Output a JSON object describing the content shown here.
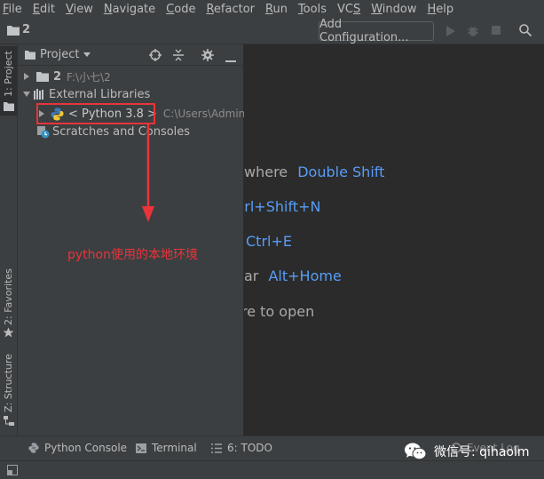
{
  "menubar": {
    "items": [
      {
        "label": "File",
        "mnemonic": "F",
        "rest": "ile"
      },
      {
        "label": "Edit",
        "mnemonic": "E",
        "rest": "dit"
      },
      {
        "label": "View",
        "mnemonic": "V",
        "rest": "iew"
      },
      {
        "label": "Navigate",
        "mnemonic": "N",
        "rest": "avigate"
      },
      {
        "label": "Code",
        "mnemonic": "C",
        "rest": "ode"
      },
      {
        "label": "Refactor",
        "mnemonic": "R",
        "rest": "efactor"
      },
      {
        "label": "Run",
        "mnemonic": "R",
        "rest": "un"
      },
      {
        "label": "Tools",
        "mnemonic": "T",
        "rest": "ools"
      },
      {
        "label": "VCS",
        "mnemonic": "S",
        "rest": "VC"
      },
      {
        "label": "Window",
        "mnemonic": "W",
        "rest": "indow"
      },
      {
        "label": "Help",
        "mnemonic": "H",
        "rest": "elp"
      }
    ]
  },
  "navbar": {
    "project_name": "2",
    "add_configuration": "Add Configuration..."
  },
  "left_stripe": {
    "project_tab": "1: Project",
    "favorites_tab": "2: Favorites",
    "structure_tab": "Z: Structure"
  },
  "project_panel": {
    "title": "Project",
    "tree": {
      "root_name": "2",
      "root_path": "F:\\小七\\2",
      "external_libraries": "External Libraries",
      "python_sdk": "< Python 3.8 >",
      "python_path": "C:\\Users\\Admin\\A",
      "scratches": "Scratches and Consoles"
    }
  },
  "welcome": {
    "line1_text": "where",
    "line1_key": "Double Shift",
    "line2_key": "trl+Shift+N",
    "line3_key": "Ctrl+E",
    "line4_text": "ar",
    "line4_key": "Alt+Home",
    "line5_text": "re to open"
  },
  "annotation": {
    "note": "python使用的本地环境"
  },
  "bottom_bar": {
    "python_console": "Python Console",
    "terminal": "Terminal",
    "todo": "6: TODO",
    "event_log": "Event Log"
  },
  "watermark": {
    "text": "微信号: qihaolm"
  },
  "colors": {
    "accent_key": "#589df6",
    "annotation_red": "#e8343a",
    "panel_bg": "#3c3f41",
    "editor_bg": "#2b2b2b"
  }
}
